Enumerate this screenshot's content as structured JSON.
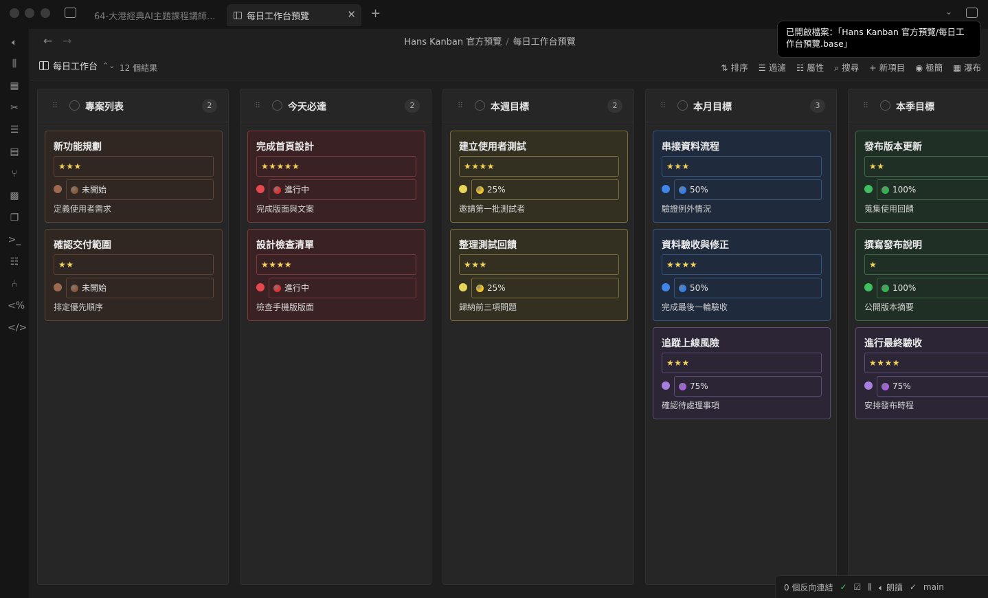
{
  "tabs": [
    {
      "label": "64-大港經典AI主題課程講師..."
    },
    {
      "label": "每日工作台預覽"
    }
  ],
  "breadcrumb": {
    "parent": "Hans Kanban 官方預覽",
    "separator": "/",
    "current": "每日工作台預覽"
  },
  "tooltip": {
    "line1": "已開啟檔案：「Hans Kanban 官方預覽/每日工",
    "line2": "作台預覽.base」"
  },
  "toolbar": {
    "view_name": "每日工作台",
    "results": "12 個結果",
    "sort": "排序",
    "filter": "過濾",
    "properties": "屬性",
    "search": "搜尋",
    "new_item": "新項目",
    "minimal": "極簡",
    "waterfall": "瀑布"
  },
  "columns": [
    {
      "title": "專案列表",
      "count": "2",
      "cards": [
        {
          "title": "新功能規劃",
          "stars": "★★★",
          "status": "未開始",
          "note": "定義使用者需求",
          "color": "brown"
        },
        {
          "title": "確認交付範圍",
          "stars": "★★",
          "status": "未開始",
          "note": "排定優先順序",
          "color": "brown"
        }
      ]
    },
    {
      "title": "今天必達",
      "count": "2",
      "cards": [
        {
          "title": "完成首頁設計",
          "stars": "★★★★★",
          "status": "進行中",
          "note": "完成版面與文案",
          "color": "red"
        },
        {
          "title": "設計檢查清單",
          "stars": "★★★★",
          "status": "進行中",
          "note": "檢查手機版版面",
          "color": "red"
        }
      ]
    },
    {
      "title": "本週目標",
      "count": "2",
      "cards": [
        {
          "title": "建立使用者測試",
          "stars": "★★★★",
          "status": "25%",
          "note": "邀請第一批測試者",
          "color": "yellow"
        },
        {
          "title": "整理測試回饋",
          "stars": "★★★",
          "status": "25%",
          "note": "歸納前三項問題",
          "color": "yellow"
        }
      ]
    },
    {
      "title": "本月目標",
      "count": "3",
      "cards": [
        {
          "title": "串接資料流程",
          "stars": "★★★",
          "status": "50%",
          "note": "驗證例外情況",
          "color": "blue"
        },
        {
          "title": "資料驗收與修正",
          "stars": "★★★★",
          "status": "50%",
          "note": "完成最後一輪驗收",
          "color": "blue"
        },
        {
          "title": "追蹤上線風險",
          "stars": "★★★",
          "status": "75%",
          "note": "確認待處理事項",
          "color": "purple"
        }
      ]
    },
    {
      "title": "本季目標",
      "count": "",
      "cards": [
        {
          "title": "發布版本更新",
          "stars": "★★",
          "status": "100%",
          "note": "蒐集使用回饋",
          "color": "green"
        },
        {
          "title": "撰寫發布說明",
          "stars": "★",
          "status": "100%",
          "note": "公開版本摘要",
          "color": "green"
        },
        {
          "title": "進行最終驗收",
          "stars": "★★★★",
          "status": "75%",
          "note": "安排發布時程",
          "color": "purple"
        }
      ]
    }
  ],
  "status_colors": {
    "brown": {
      "dot": "#9c6a4e",
      "emoji": "#8a5a3a"
    },
    "red": {
      "dot": "#e5484d",
      "emoji": "#e0302f"
    },
    "yellow": {
      "dot": "#e6d55a",
      "emoji": "#f3c623"
    },
    "blue": {
      "dot": "#3f86e8",
      "emoji": "#2f7ff0"
    },
    "purple": {
      "dot": "#a77fe0",
      "emoji": "#a85ee8"
    },
    "green": {
      "dot": "#3fbf62",
      "emoji": "#28b84a"
    }
  },
  "statusbar": {
    "backlinks": "0 個反向連結",
    "read_aloud": "朗讀",
    "branch": "main"
  }
}
